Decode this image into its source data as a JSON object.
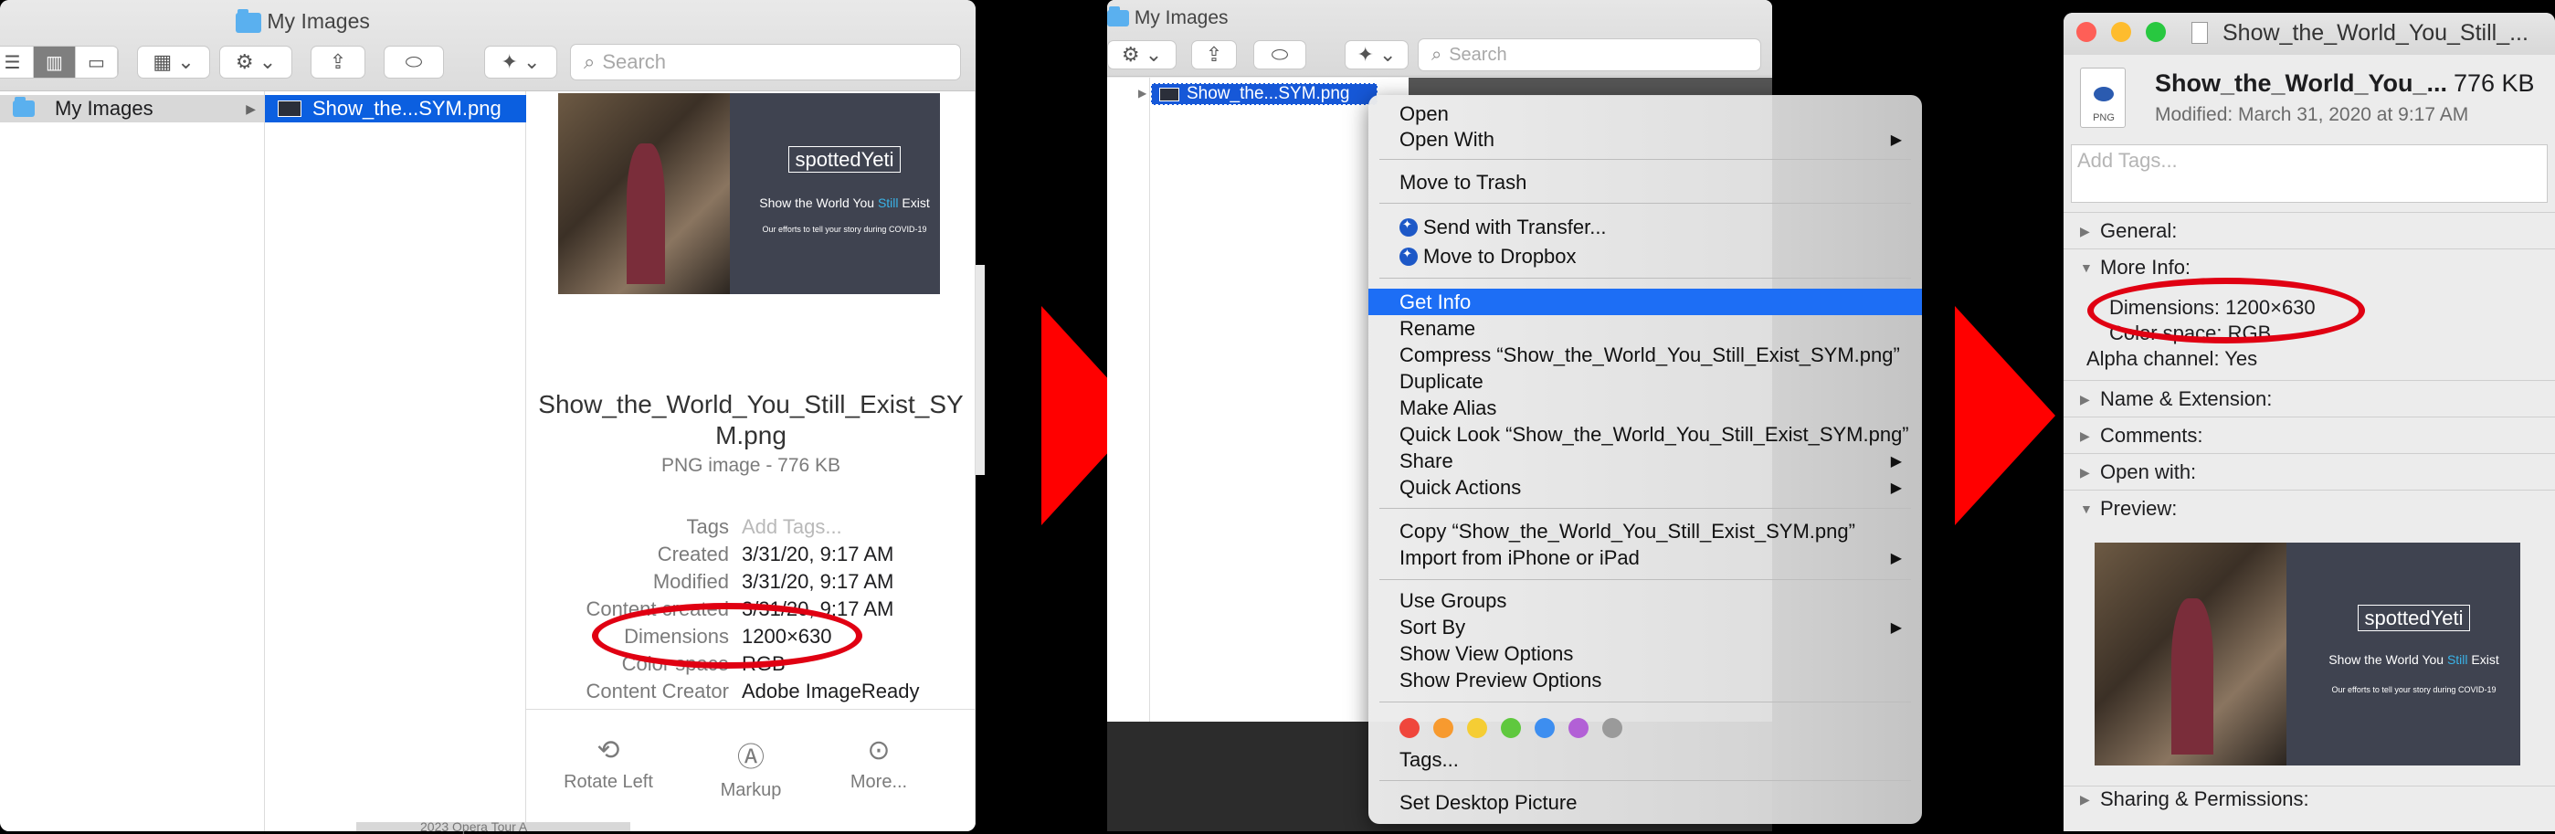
{
  "panel1": {
    "window_title": "My Images",
    "search_placeholder": "Search",
    "sidebar_folder": "My Images",
    "selected_file": "Show_the...SYM.png",
    "preview": {
      "brand": "spottedYeti",
      "headline_a": "Show the World You ",
      "headline_b": "Still",
      "headline_c": " Exist",
      "tagline": "Our efforts to tell your story during COVID-19"
    },
    "file_name_line1": "Show_the_World_You_Still_Exist_SY",
    "file_name_line2": "M.png",
    "file_kind": "PNG image - 776 KB",
    "info": [
      {
        "label": "Tags",
        "value": "Add Tags..."
      },
      {
        "label": "Created",
        "value": "3/31/20, 9:17 AM"
      },
      {
        "label": "Modified",
        "value": "3/31/20, 9:17 AM"
      },
      {
        "label": "Content created",
        "value": "3/31/20, 9:17 AM"
      },
      {
        "label": "Dimensions",
        "value": "1200×630"
      },
      {
        "label": "Color space",
        "value": "RGB"
      },
      {
        "label": "Content Creator",
        "value": "Adobe ImageReady"
      }
    ],
    "actions": [
      "Rotate Left",
      "Markup",
      "More..."
    ],
    "behind_text": "2023 Opera Tour A"
  },
  "panel2": {
    "window_title": "My Images",
    "search_placeholder": "Search",
    "selected_file": "Show_the...SYM.png",
    "menu": [
      {
        "label": "Open"
      },
      {
        "label": "Open With",
        "submenu": "▶"
      },
      {
        "label": "Move to Trash"
      },
      {
        "label": "Send with Transfer..."
      },
      {
        "label": "Move to Dropbox"
      },
      {
        "label": "Get Info"
      },
      {
        "label": "Rename"
      },
      {
        "label": "Compress “Show_the_World_You_Still_Exist_SYM.png”"
      },
      {
        "label": "Duplicate"
      },
      {
        "label": "Make Alias"
      },
      {
        "label": "Quick Look “Show_the_World_You_Still_Exist_SYM.png”"
      },
      {
        "label": "Share",
        "submenu": "▶"
      },
      {
        "label": "Quick Actions",
        "submenu": "▶"
      },
      {
        "label": "Copy “Show_the_World_You_Still_Exist_SYM.png”"
      },
      {
        "label": "Import from iPhone or iPad",
        "submenu": "▶"
      },
      {
        "label": "Use Groups"
      },
      {
        "label": "Sort By",
        "submenu": "▶"
      },
      {
        "label": "Show View Options"
      },
      {
        "label": "Show Preview Options"
      },
      {
        "label": "Tags..."
      },
      {
        "label": "Set Desktop Picture"
      }
    ],
    "tag_colors": [
      "#f0463c",
      "#f79a2f",
      "#f5cd34",
      "#5fc83e",
      "#3d8ef0",
      "#b260d6",
      "#9a9a9a"
    ]
  },
  "panel3": {
    "window_title": "Show_the_World_You_Still_...",
    "file_name": "Show_the_World_You_...",
    "file_size": "776 KB",
    "modified": "Modified: March 31, 2020 at 9:17 AM",
    "icon_label": "PNG",
    "tags_placeholder": "Add Tags...",
    "general": "General:",
    "more_info": "More Info:",
    "dimensions": "Dimensions: 1200×630",
    "color_space": "Color space: RGB",
    "alpha": "Alpha channel: Yes",
    "name_ext": "Name & Extension:",
    "comments": "Comments:",
    "open_with": "Open with:",
    "preview": "Preview:",
    "sharing": "Sharing & Permissions:"
  },
  "colors": {
    "highlight_blue": "#1d6ef5",
    "annotation_red": "#e00012",
    "arrow_red": "#ff0000"
  }
}
